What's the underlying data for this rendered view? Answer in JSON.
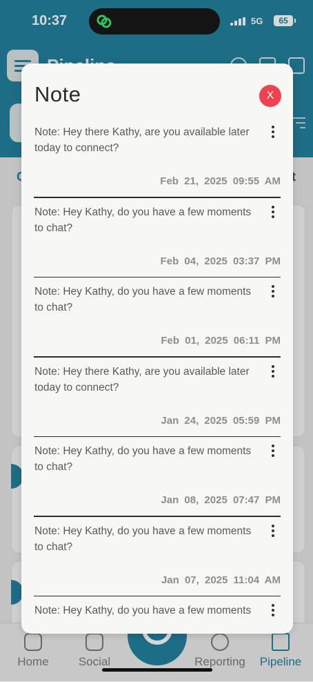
{
  "status": {
    "time": "10:37",
    "network": "5G",
    "battery": "65"
  },
  "app": {
    "title": "Pipeline",
    "peek_left": "C",
    "peek_right": "t"
  },
  "nav": {
    "items": [
      {
        "label": "Home"
      },
      {
        "label": "Social"
      },
      {
        "label": "Reporting"
      },
      {
        "label": "Pipeline"
      }
    ]
  },
  "modal": {
    "title": "Note",
    "close_label": "X",
    "notes": [
      {
        "text": "Note: Hey there Kathy, are you available later today to connect?",
        "date": "Feb 21, 2025  09:55 AM"
      },
      {
        "text": "Note: Hey Kathy, do you have a few moments to chat?",
        "date": "Feb 04, 2025  03:37 PM"
      },
      {
        "text": "Note: Hey Kathy, do you have a few moments to chat?",
        "date": "Feb 01, 2025  06:11 PM"
      },
      {
        "text": "Note: Hey there Kathy, are you available later today to connect?",
        "date": "Jan 24, 2025  05:59 PM"
      },
      {
        "text": "Note: Hey Kathy, do you have a few moments to chat?",
        "date": "Jan 08, 2025  07:47 PM"
      },
      {
        "text": "Note: Hey Kathy, do you have a few moments to chat?",
        "date": "Jan 07, 2025  11:04 AM"
      },
      {
        "text": "Note: Hey Kathy, do you have a few moments",
        "date": ""
      }
    ]
  },
  "colors": {
    "accent": "#1a7d9a",
    "close": "#f0414f"
  }
}
